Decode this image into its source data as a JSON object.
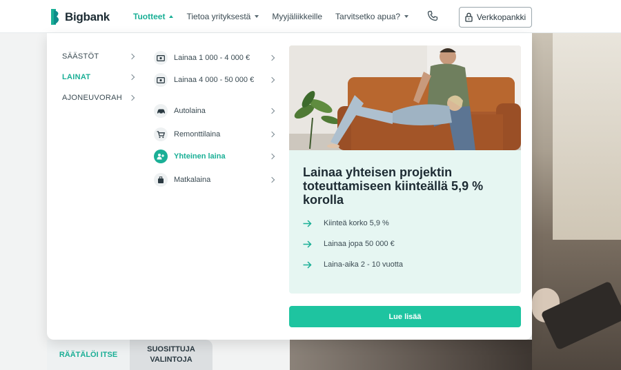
{
  "brand": {
    "name": "Bigbank",
    "accent": "#1aaf96",
    "cta_color": "#1ec4a0"
  },
  "nav": {
    "items": [
      {
        "label": "Tuotteet",
        "caret": "up"
      },
      {
        "label": "Tietoa yrityksestä",
        "caret": "down"
      },
      {
        "label": "Myyjäliikkeille",
        "caret": ""
      },
      {
        "label": "Tarvitsetko apua?",
        "caret": "down"
      }
    ],
    "phone_icon": "phone-icon",
    "bank_button": "Verkkopankki"
  },
  "menu": {
    "categories": [
      {
        "label": "SÄÄSTÖT",
        "active": false
      },
      {
        "label": "LAINAT",
        "active": true
      },
      {
        "label": "AJONEUVORAH",
        "active": false
      }
    ],
    "products": [
      {
        "label": "Lainaa 1 000 - 4 000 €",
        "icon": "money-icon",
        "active": false
      },
      {
        "label": "Lainaa 4 000 - 50 000 €",
        "icon": "money-icon",
        "active": false
      },
      {
        "label": "Autolaina",
        "icon": "car-icon",
        "active": false
      },
      {
        "label": "Remonttilaina",
        "icon": "cart-icon",
        "active": false
      },
      {
        "label": "Yhteinen laina",
        "icon": "couple-icon",
        "active": true
      },
      {
        "label": "Matkalaina",
        "icon": "luggage-icon",
        "active": false
      }
    ]
  },
  "promo": {
    "title": "Lainaa yhteisen projektin toteuttamiseen kiinteällä 5,9 % korolla",
    "bullets": [
      "Kiinteä korko 5,9 %",
      "Lainaa jopa 50 000 €",
      "Laina-aika 2 - 10 vuotta"
    ],
    "cta": "Lue lisää"
  },
  "tabs": [
    "RÄÄTÄLÖI ITSE",
    "SUOSITTUJA VALINTOJA"
  ]
}
